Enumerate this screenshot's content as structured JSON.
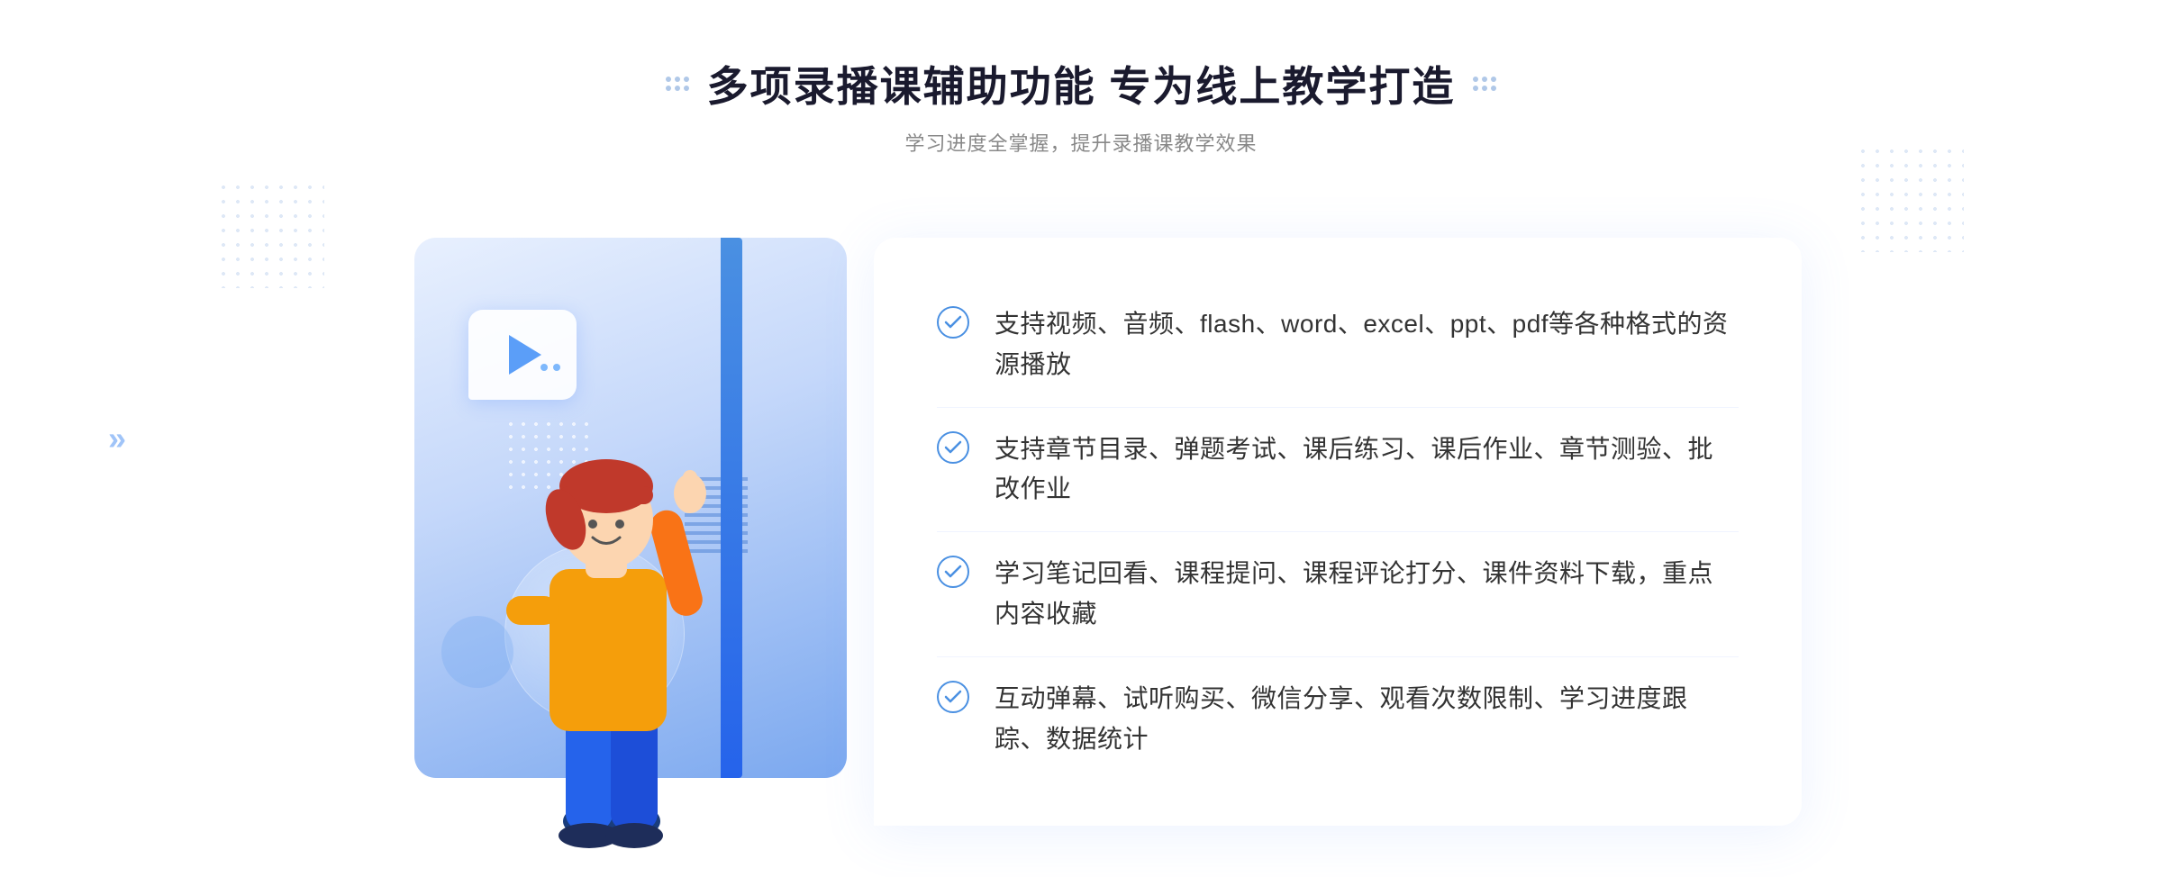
{
  "page": {
    "background": "#ffffff"
  },
  "header": {
    "title": "多项录播课辅助功能 专为线上教学打造",
    "subtitle": "学习进度全掌握，提升录播课教学效果"
  },
  "features": [
    {
      "id": 1,
      "text": "支持视频、音频、flash、word、excel、ppt、pdf等各种格式的资源播放"
    },
    {
      "id": 2,
      "text": "支持章节目录、弹题考试、课后练习、课后作业、章节测验、批改作业"
    },
    {
      "id": 3,
      "text": "学习笔记回看、课程提问、课程评论打分、课件资料下载，重点内容收藏"
    },
    {
      "id": 4,
      "text": "互动弹幕、试听购买、微信分享、观看次数限制、学习进度跟踪、数据统计"
    }
  ],
  "icons": {
    "check": "✓",
    "play": "▶",
    "chevron_left": "»"
  }
}
